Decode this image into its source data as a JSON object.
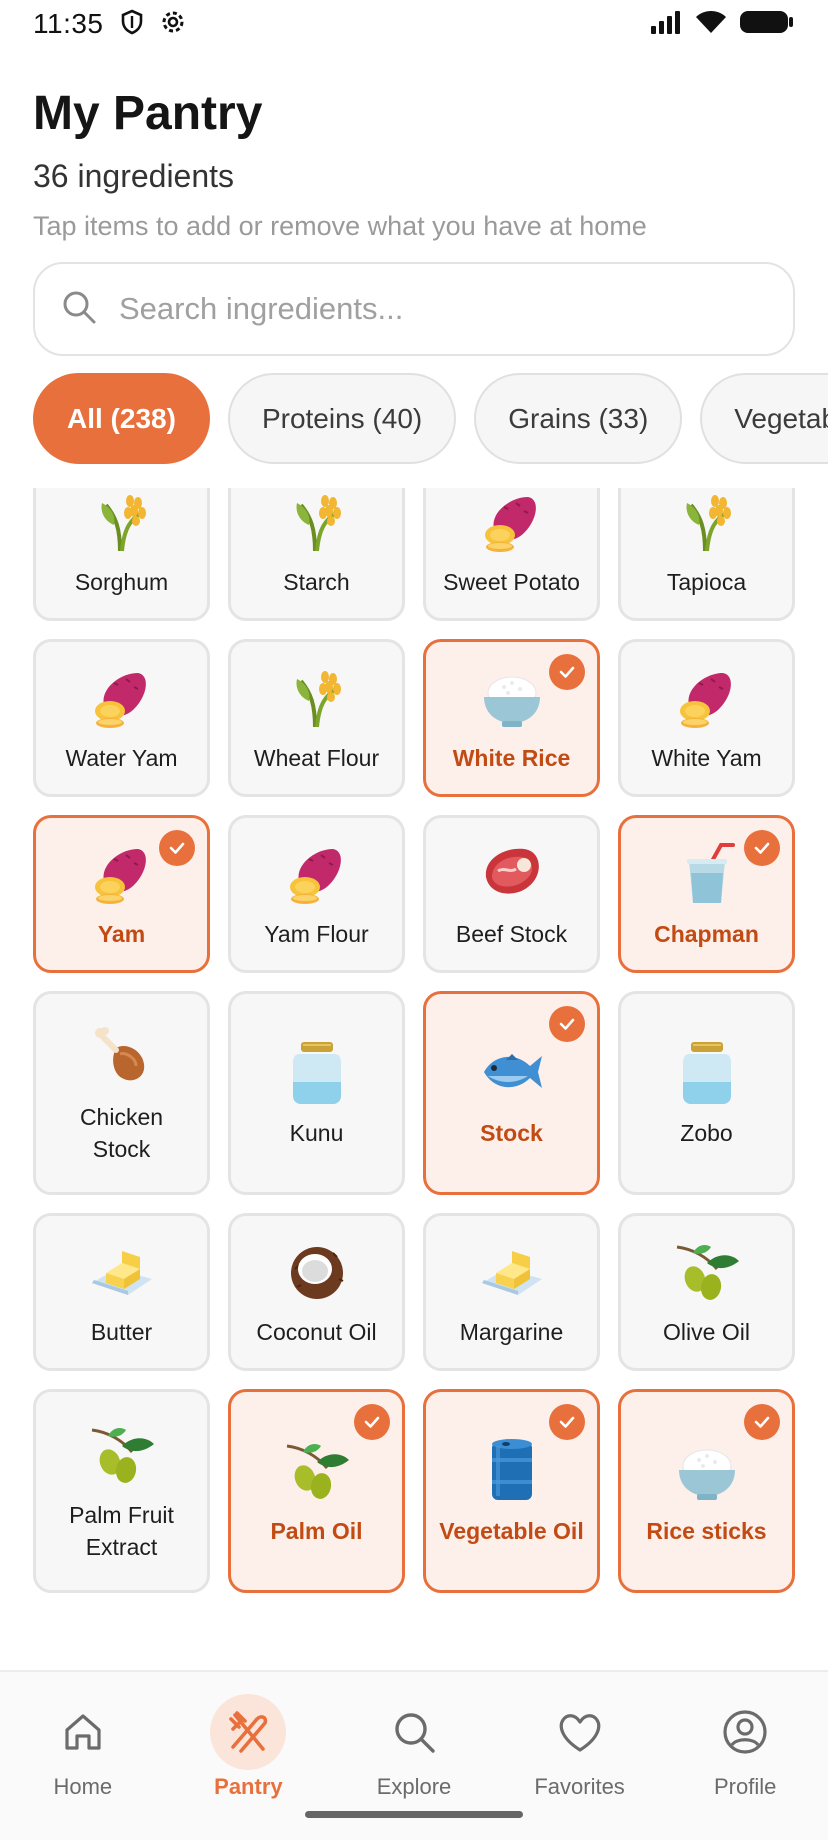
{
  "status": {
    "time": "11:35"
  },
  "header": {
    "title": "My Pantry",
    "count": "36 ingredients",
    "hint": "Tap items to add or remove what you have at home"
  },
  "search": {
    "placeholder": "Search ingredients..."
  },
  "chips": [
    {
      "label": "All (238)",
      "active": true
    },
    {
      "label": "Proteins (40)",
      "active": false
    },
    {
      "label": "Grains (33)",
      "active": false
    },
    {
      "label": "Vegetables",
      "active": false
    }
  ],
  "items": [
    {
      "label": "Sorghum",
      "icon": "grain-icon",
      "selected": false
    },
    {
      "label": "Starch",
      "icon": "grain-icon",
      "selected": false
    },
    {
      "label": "Sweet Potato",
      "icon": "sweet-potato-icon",
      "selected": false
    },
    {
      "label": "Tapioca",
      "icon": "grain-icon",
      "selected": false
    },
    {
      "label": "Water Yam",
      "icon": "sweet-potato-icon",
      "selected": false
    },
    {
      "label": "Wheat Flour",
      "icon": "grain-icon",
      "selected": false
    },
    {
      "label": "White Rice",
      "icon": "rice-bowl-icon",
      "selected": true
    },
    {
      "label": "White Yam",
      "icon": "sweet-potato-icon",
      "selected": false
    },
    {
      "label": "Yam",
      "icon": "sweet-potato-icon",
      "selected": true
    },
    {
      "label": "Yam Flour",
      "icon": "sweet-potato-icon",
      "selected": false
    },
    {
      "label": "Beef Stock",
      "icon": "meat-icon",
      "selected": false
    },
    {
      "label": "Chapman",
      "icon": "cup-straw-icon",
      "selected": true
    },
    {
      "label": "Chicken Stock",
      "icon": "drumstick-icon",
      "selected": false
    },
    {
      "label": "Kunu",
      "icon": "jar-icon",
      "selected": false
    },
    {
      "label": "Stock",
      "icon": "fish-icon",
      "selected": true
    },
    {
      "label": "Zobo",
      "icon": "jar-icon",
      "selected": false
    },
    {
      "label": "Butter",
      "icon": "butter-icon",
      "selected": false
    },
    {
      "label": "Coconut Oil",
      "icon": "coconut-icon",
      "selected": false
    },
    {
      "label": "Margarine",
      "icon": "butter-icon",
      "selected": false
    },
    {
      "label": "Olive Oil",
      "icon": "olive-icon",
      "selected": false
    },
    {
      "label": "Palm Fruit Extract",
      "icon": "olive-icon",
      "selected": false
    },
    {
      "label": "Palm Oil",
      "icon": "olive-icon",
      "selected": true
    },
    {
      "label": "Vegetable Oil",
      "icon": "oil-drum-icon",
      "selected": true
    },
    {
      "label": "Rice sticks",
      "icon": "rice-bowl-icon",
      "selected": true
    }
  ],
  "nav": [
    {
      "label": "Home",
      "icon": "home-icon",
      "active": false
    },
    {
      "label": "Pantry",
      "icon": "utensils-icon",
      "active": true
    },
    {
      "label": "Explore",
      "icon": "search-icon",
      "active": false
    },
    {
      "label": "Favorites",
      "icon": "heart-icon",
      "active": false
    },
    {
      "label": "Profile",
      "icon": "profile-icon",
      "active": false
    }
  ],
  "colors": {
    "accent": "#e8703c",
    "selected_bg": "#fdf0eb",
    "selected_text": "#c24b14"
  }
}
